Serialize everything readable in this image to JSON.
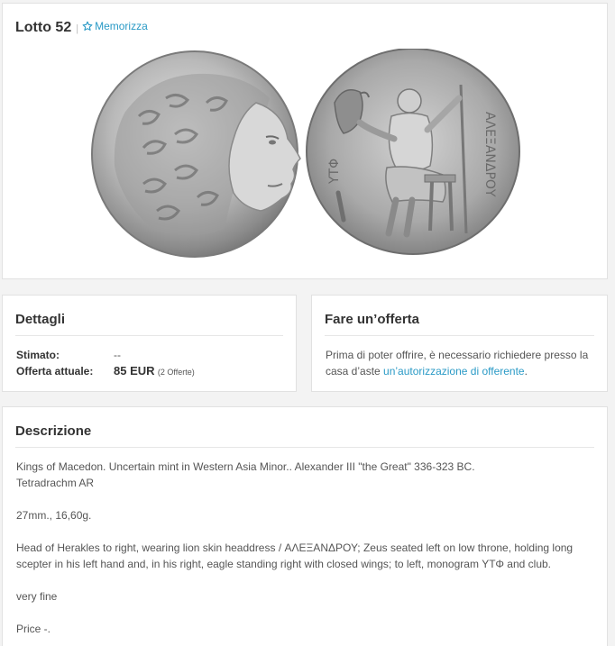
{
  "lot": {
    "title": "Lotto 52",
    "separator": "|",
    "save_label": "Memorizza"
  },
  "details": {
    "title": "Dettagli",
    "estimate_label": "Stimato:",
    "estimate_value": "--",
    "current_offer_label": "Offerta attuale:",
    "current_offer_value": "85 EUR",
    "offer_count": "(2 Offerte)"
  },
  "offer": {
    "title": "Fare un’offerta",
    "text": "Prima di poter offrire, è necessario richiedere presso la casa d’aste ",
    "link_text": "un’autorizzazione di offerente",
    "text_end": "."
  },
  "description": {
    "title": "Descrizione",
    "line1": "Kings of Macedon. Uncertain mint in Western Asia Minor.. Alexander III \"the Great\" 336-323 BC.",
    "line2": "Tetradrachm AR",
    "line3": "27mm., 16,60g.",
    "line4": "Head of Herakles to right, wearing lion skin headdress / ΑΛΕΞΑΝΔΡΟΥ; Zeus seated left on low throne, holding long scepter in his left hand and, in his right, eagle standing right with closed wings; to left, monogram ΥΤΦ and club.",
    "line5": "very fine",
    "line6": "Price -."
  },
  "icons": {
    "save": "star-outline-icon"
  },
  "colors": {
    "link": "#2a9ac6",
    "background": "#f3f3f3",
    "card": "#ffffff",
    "coin_silver": "#b8b8b8"
  }
}
